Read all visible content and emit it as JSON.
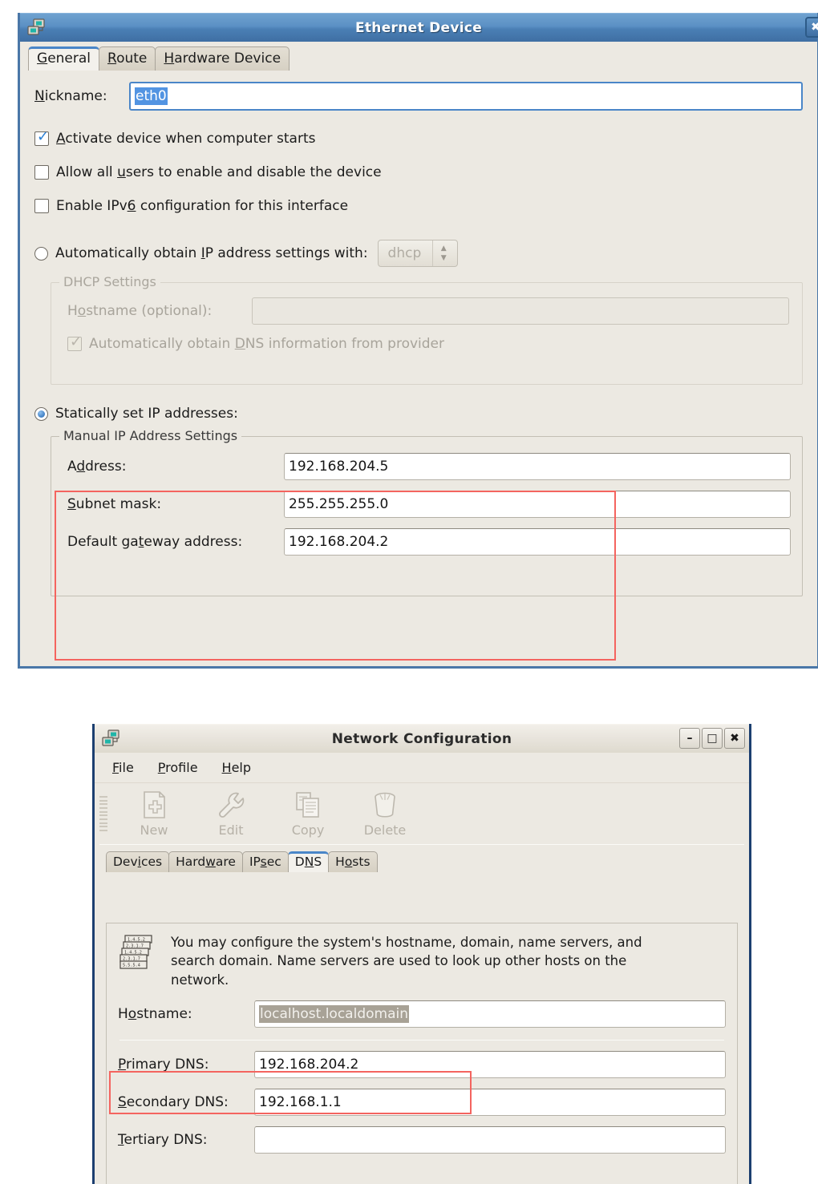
{
  "ethernet_window": {
    "title": "Ethernet Device",
    "icon": "network-device-icon",
    "close_label": "✖",
    "tabs": [
      {
        "label": "General",
        "mnemonic": "G",
        "active": true
      },
      {
        "label": "Route",
        "mnemonic": "R",
        "active": false
      },
      {
        "label": "Hardware Device",
        "mnemonic": "H",
        "active": false
      }
    ],
    "nickname": {
      "label": "Nickname:",
      "mnemonic": "N",
      "value": "eth0"
    },
    "checkboxes": [
      {
        "label_pre": "",
        "mnemonic": "A",
        "label_post": "ctivate device when computer starts",
        "checked": true,
        "disabled": false
      },
      {
        "label_pre": "Allow all ",
        "mnemonic": "u",
        "label_post": "sers to enable and disable the device",
        "checked": false,
        "disabled": false
      },
      {
        "label_pre": "Enable IPv",
        "mnemonic": "6",
        "label_post": " configuration for this interface",
        "checked": false,
        "disabled": false
      }
    ],
    "auto_radio": {
      "label_pre": "Automatically obtain ",
      "mnemonic": "I",
      "label_post": "P address settings with:",
      "selected": false,
      "combo_value": "dhcp"
    },
    "dhcp_frame": {
      "title": "DHCP Settings",
      "hostname_label_pre": "H",
      "hostname_mnemonic": "o",
      "hostname_label_post": "stname (optional):",
      "hostname_value": "",
      "auto_dns_pre": "Automatically obtain ",
      "auto_dns_mnemonic": "D",
      "auto_dns_post": "NS information from provider",
      "auto_dns_checked": true
    },
    "static_radio": {
      "label": "Statically set IP addresses:",
      "selected": true
    },
    "manual_frame": {
      "title": "Manual IP Address Settings",
      "fields": [
        {
          "label_pre": "A",
          "mnemonic": "d",
          "label_post": "dress:",
          "value": "192.168.204.5",
          "name": "address"
        },
        {
          "label_pre": "",
          "mnemonic": "S",
          "label_post": "ubnet mask:",
          "value": "255.255.255.0",
          "name": "subnet-mask"
        },
        {
          "label_pre": "Default ga",
          "mnemonic": "t",
          "label_post": "eway address:",
          "value": "192.168.204.2",
          "name": "default-gateway"
        }
      ]
    }
  },
  "network_config_window": {
    "title": "Network Configuration",
    "icon": "network-config-icon",
    "window_buttons": {
      "minimize": "–",
      "maximize": "□",
      "close": "✖"
    },
    "menus": [
      {
        "label_pre": "",
        "mnemonic": "F",
        "label_post": "ile"
      },
      {
        "label_pre": "",
        "mnemonic": "P",
        "label_post": "rofile"
      },
      {
        "label_pre": "",
        "mnemonic": "H",
        "label_post": "elp"
      }
    ],
    "toolbar": [
      {
        "label": "New",
        "icon": "new-document-icon",
        "disabled": true
      },
      {
        "label": "Edit",
        "icon": "wrench-icon",
        "disabled": true
      },
      {
        "label": "Copy",
        "icon": "copy-pages-icon",
        "disabled": true
      },
      {
        "label": "Delete",
        "icon": "trash-can-icon",
        "disabled": true
      }
    ],
    "tabs": [
      {
        "label_pre": "Dev",
        "mnemonic": "i",
        "label_post": "ces",
        "active": false
      },
      {
        "label_pre": "Hard",
        "mnemonic": "w",
        "label_post": "are",
        "active": false
      },
      {
        "label_pre": "IP",
        "mnemonic": "s",
        "label_post": "ec",
        "active": false
      },
      {
        "label_pre": "D",
        "mnemonic": "N",
        "label_post": "S",
        "active": true
      },
      {
        "label_pre": "H",
        "mnemonic": "o",
        "label_post": "sts",
        "active": false
      }
    ],
    "description": "You may configure the system's hostname, domain, name servers, and search domain. Name servers are used to look up other hosts on the network.",
    "description_icon": "dns-records-stack-icon",
    "hostname": {
      "label_pre": "H",
      "mnemonic": "o",
      "label_post": "stname:",
      "value": "localhost.localdomain"
    },
    "dns_fields": [
      {
        "label_pre": "",
        "mnemonic": "P",
        "label_post": "rimary DNS:",
        "value": "192.168.204.2",
        "name": "primary-dns"
      },
      {
        "label_pre": "",
        "mnemonic": "S",
        "label_post": "econdary DNS:",
        "value": "192.168.1.1",
        "name": "secondary-dns"
      },
      {
        "label_pre": "",
        "mnemonic": "T",
        "label_post": "ertiary DNS:",
        "value": "",
        "name": "tertiary-dns"
      }
    ]
  },
  "annotations": {
    "color": "#f4645f",
    "boxes": [
      {
        "name": "manual-ip-settings-highlight"
      },
      {
        "name": "primary-dns-highlight"
      }
    ]
  }
}
